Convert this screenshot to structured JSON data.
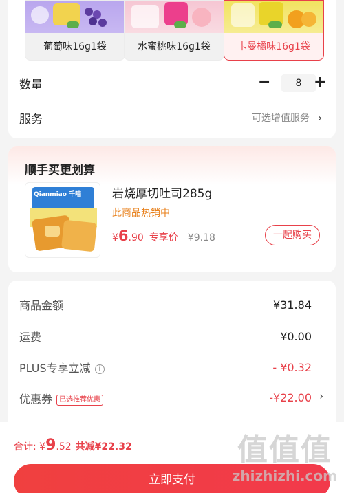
{
  "flavors": [
    {
      "label": "葡萄味16g1袋",
      "selected": false,
      "color": "#b9a6ee"
    },
    {
      "label": "水蜜桃味16g1袋",
      "selected": false,
      "color": "#f6c6d3"
    },
    {
      "label": "卡曼橘味16g1袋",
      "selected": true,
      "color": "#f2e35f"
    }
  ],
  "quantity": {
    "label": "数量",
    "minus": "−",
    "value": "8",
    "plus": "+"
  },
  "service": {
    "label": "服务",
    "value": "可选增值服务",
    "chevron": "›"
  },
  "bundle": {
    "title": "顺手买更划算",
    "product_name": "岩烧厚切吐司285g",
    "hot_text": "此商品热销中",
    "currency": "¥",
    "price_int": "6",
    "price_dec": ".90",
    "price_tag": "专享价",
    "orig_price": "¥9.18",
    "buy_label": "一起购买",
    "brand_text": "Qianmiao 千喵"
  },
  "summary": {
    "goods_label": "商品金额",
    "goods_value": "¥31.84",
    "shipping_label": "运费",
    "shipping_value": "¥0.00",
    "plus_label": "PLUS专享立减",
    "plus_info": "i",
    "plus_value": "- ¥0.32",
    "coupon_label": "优惠券",
    "coupon_tag": "已选推荐优惠",
    "coupon_value": "-¥22.00",
    "coupon_chevron": "›"
  },
  "bottom": {
    "total_label": "合计: ",
    "currency": "¥",
    "total_int": "9",
    "total_dec": ".52",
    "save_text": "共减¥22.32",
    "pay_label": "立即支付"
  },
  "watermark": {
    "line1": "值值值",
    "line2": "zhizhizhi.com"
  },
  "colors": {
    "accent": "#e8414a",
    "hot": "#e8821e",
    "pay": "#f0403f"
  }
}
